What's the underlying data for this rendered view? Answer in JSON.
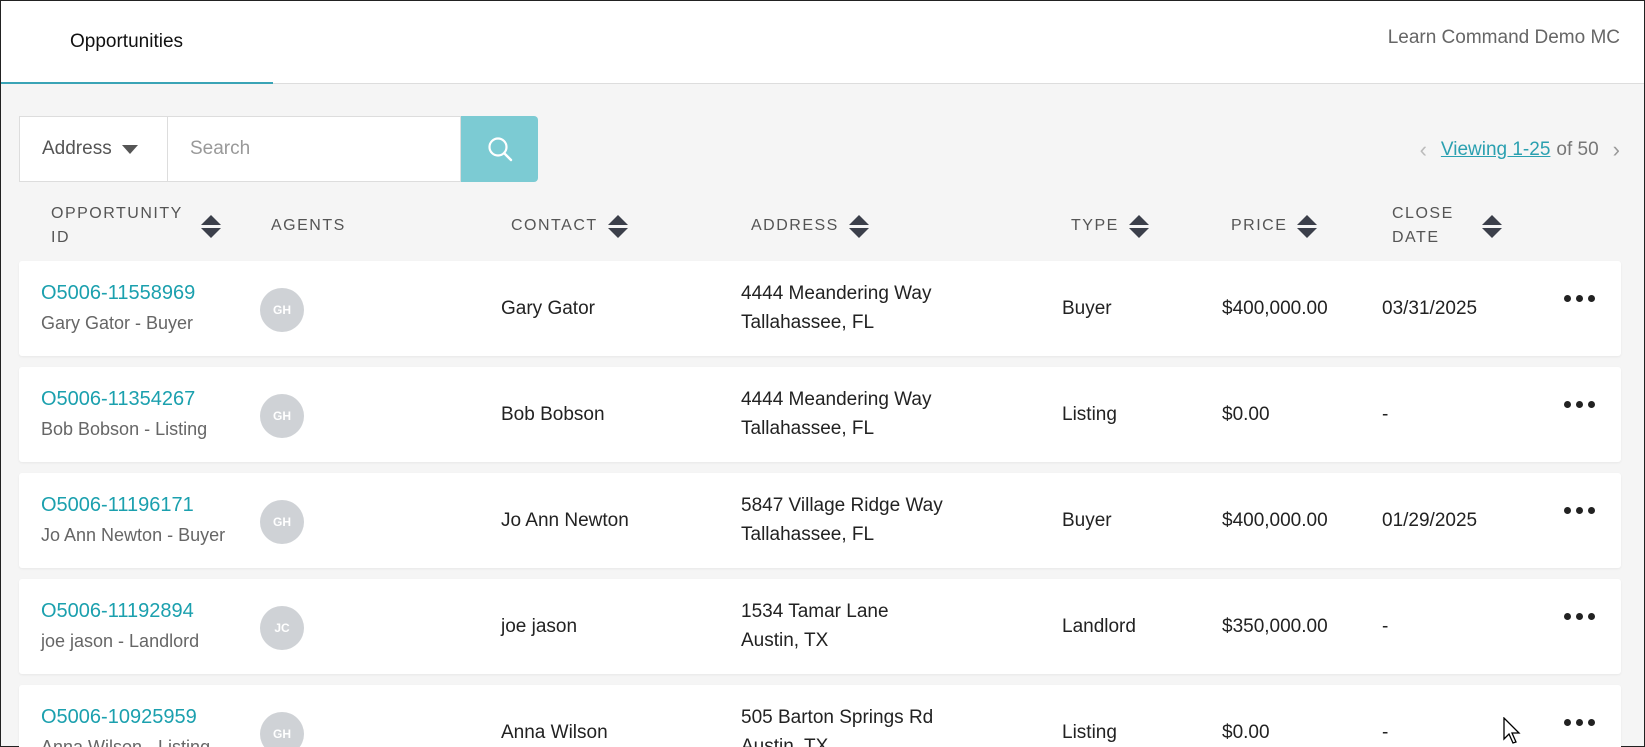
{
  "header": {
    "tab_label": "Opportunities",
    "account_name": "Learn Command Demo MC"
  },
  "search": {
    "field_label": "Address",
    "placeholder": "Search"
  },
  "pager": {
    "viewing": "Viewing 1-25",
    "of_total": "of 50"
  },
  "columns": {
    "opportunity_id": "OPPORTUNITY ID",
    "agents": "AGENTS",
    "contact": "CONTACT",
    "address": "ADDRESS",
    "type": "TYPE",
    "price": "PRICE",
    "close_date": "CLOSE DATE"
  },
  "rows": [
    {
      "id": "O5006-11558969",
      "subtitle": "Gary Gator - Buyer",
      "agent": "GH",
      "contact": "Gary Gator",
      "address1": "4444 Meandering Way",
      "address2": "Tallahassee, FL",
      "type": "Buyer",
      "price": "$400,000.00",
      "close": "03/31/2025"
    },
    {
      "id": "O5006-11354267",
      "subtitle": "Bob Bobson - Listing",
      "agent": "GH",
      "contact": "Bob Bobson",
      "address1": "4444 Meandering Way",
      "address2": "Tallahassee, FL",
      "type": "Listing",
      "price": "$0.00",
      "close": "-"
    },
    {
      "id": "O5006-11196171",
      "subtitle": "Jo Ann Newton - Buyer",
      "agent": "GH",
      "contact": "Jo Ann Newton",
      "address1": "5847 Village Ridge Way",
      "address2": "Tallahassee, FL",
      "type": "Buyer",
      "price": "$400,000.00",
      "close": "01/29/2025"
    },
    {
      "id": "O5006-11192894",
      "subtitle": "joe jason - Landlord",
      "agent": "JC",
      "contact": "joe jason",
      "address1": "1534 Tamar Lane",
      "address2": "Austin, TX",
      "type": "Landlord",
      "price": "$350,000.00",
      "close": "-"
    },
    {
      "id": "O5006-10925959",
      "subtitle": "Anna Wilson - Listing",
      "agent": "GH",
      "contact": "Anna Wilson",
      "address1": "505 Barton Springs Rd",
      "address2": "Austin, TX",
      "type": "Listing",
      "price": "$0.00",
      "close": "-"
    }
  ],
  "colors": {
    "accent": "#1ba0ae",
    "search_button": "#7ccbd3",
    "avatar": "#cfd2d6"
  },
  "icons": {
    "search": "search-icon",
    "sort": "sort-icon",
    "more": "more-icon",
    "dropdown": "caret-down-icon",
    "prev": "chevron-left-icon",
    "next": "chevron-right-icon"
  }
}
